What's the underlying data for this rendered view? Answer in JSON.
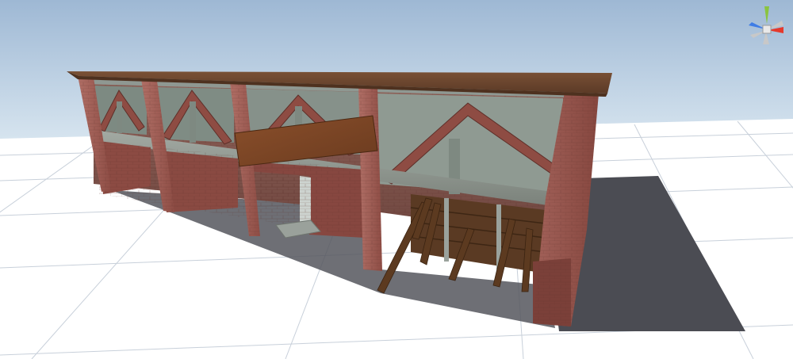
{
  "scene": {
    "sky_top_color": "#9fb9d6",
    "sky_bottom_color": "#d2e2ef",
    "ground_color": "#ffffff",
    "grid_line_color": "#c9d2dc",
    "shadow_color": "#4a4b52"
  },
  "building": {
    "roof_color": "#6b4630",
    "brick_color": "#9a5b52",
    "brick_dark_color": "#6e3a34",
    "concrete_color": "#8d958d",
    "wood_color": "#5e3b22",
    "board_color": "#7a4525"
  },
  "gizmo": {
    "icon": "scene-orientation-gizmo-icon",
    "x_axis_color": "#e5392c",
    "y_axis_color": "#8ac43f",
    "z_axis_color": "#3f7de6",
    "label": ""
  }
}
